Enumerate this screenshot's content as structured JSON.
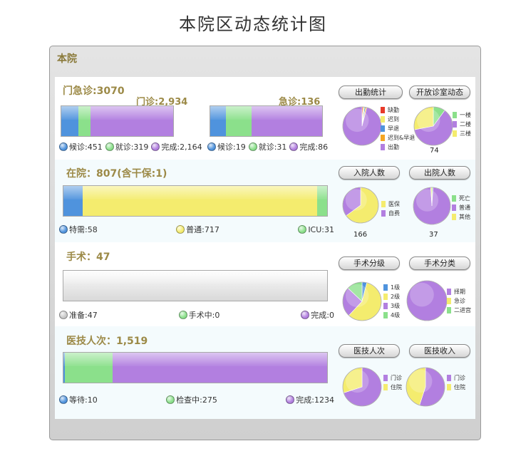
{
  "page_title": "本院区动态统计图",
  "panel_title": "本院",
  "colors": {
    "blue": "#4f93dd",
    "green": "#8be08b",
    "purple": "#b27fe0",
    "yellow": "#f4ec6e",
    "gray": "#c8c8c8",
    "red": "#e83a2a",
    "orange": "#f5a623"
  },
  "outpatient": {
    "title": "门急诊:3070",
    "clinic_label": "门诊:2,934",
    "emergency_label": "急诊:136",
    "clinic_legend": [
      {
        "label": "候诊:451",
        "color": "blue",
        "value": 451
      },
      {
        "label": "就诊:319",
        "color": "green",
        "value": 319
      },
      {
        "label": "完成:2,164",
        "color": "purple",
        "value": 2164
      }
    ],
    "emergency_legend": [
      {
        "label": "候诊:19",
        "color": "blue",
        "value": 19
      },
      {
        "label": "就诊:31",
        "color": "green",
        "value": 31
      },
      {
        "label": "完成:86",
        "color": "purple",
        "value": 86
      }
    ],
    "buttons": [
      "出勤统计",
      "开放诊室动态"
    ],
    "pie1_keys": [
      {
        "label": "缺勤",
        "color": "red",
        "value": 1
      },
      {
        "label": "迟到",
        "color": "yellow",
        "value": 1
      },
      {
        "label": "早退",
        "color": "blue",
        "value": 1
      },
      {
        "label": "迟到&早退",
        "color": "orange",
        "value": 1
      },
      {
        "label": "出勤",
        "color": "purple",
        "value": 96
      }
    ],
    "pie2_keys": [
      {
        "label": "一楼",
        "color": "green",
        "value": 10
      },
      {
        "label": "二楼",
        "color": "purple",
        "value": 62
      },
      {
        "label": "三楼",
        "color": "yellow",
        "value": 28
      }
    ],
    "pie2_count": "74"
  },
  "inpatient": {
    "title": "在院：807(含干保:1)",
    "legend": [
      {
        "label": "特需:58",
        "color": "blue",
        "value": 58
      },
      {
        "label": "普通:717",
        "color": "yellow",
        "value": 717
      },
      {
        "label": "ICU:31",
        "color": "green",
        "value": 31
      }
    ],
    "buttons": [
      "入院人数",
      "出院人数"
    ],
    "pie1_keys": [
      {
        "label": "医保",
        "color": "yellow",
        "value": 65
      },
      {
        "label": "自费",
        "color": "purple",
        "value": 35
      }
    ],
    "pie1_count": "166",
    "pie2_keys": [
      {
        "label": "死亡",
        "color": "green",
        "value": 1
      },
      {
        "label": "普通",
        "color": "purple",
        "value": 98
      },
      {
        "label": "其他",
        "color": "yellow",
        "value": 1
      }
    ],
    "pie2_count": "37"
  },
  "surgery": {
    "title": "手术：47",
    "legend": [
      {
        "label": "准备:47",
        "color": "gray",
        "value": 47
      },
      {
        "label": "手术中:0",
        "color": "green",
        "value": 0
      },
      {
        "label": "完成:0",
        "color": "purple",
        "value": 0
      }
    ],
    "buttons": [
      "手术分级",
      "手术分类"
    ],
    "pie1_keys": [
      {
        "label": "1级",
        "color": "blue",
        "value": 4
      },
      {
        "label": "2级",
        "color": "yellow",
        "value": 58
      },
      {
        "label": "3级",
        "color": "purple",
        "value": 25
      },
      {
        "label": "4级",
        "color": "green",
        "value": 13
      }
    ],
    "pie2_keys": [
      {
        "label": "择期",
        "color": "purple",
        "value": 100
      },
      {
        "label": "急诊",
        "color": "yellow",
        "value": 0
      },
      {
        "label": "二进宫",
        "color": "green",
        "value": 0
      }
    ]
  },
  "tech": {
    "title": "医技人次：1,519",
    "legend": [
      {
        "label": "等待:10",
        "color": "blue",
        "value": 10
      },
      {
        "label": "检查中:275",
        "color": "green",
        "value": 275
      },
      {
        "label": "完成:1234",
        "color": "purple",
        "value": 1234
      }
    ],
    "buttons": [
      "医技人次",
      "医技收入"
    ],
    "pie1_keys": [
      {
        "label": "门诊",
        "color": "purple",
        "value": 70
      },
      {
        "label": "住院",
        "color": "yellow",
        "value": 30
      }
    ],
    "pie2_keys": [
      {
        "label": "门诊",
        "color": "purple",
        "value": 55
      },
      {
        "label": "住院",
        "color": "yellow",
        "value": 45
      }
    ]
  }
}
